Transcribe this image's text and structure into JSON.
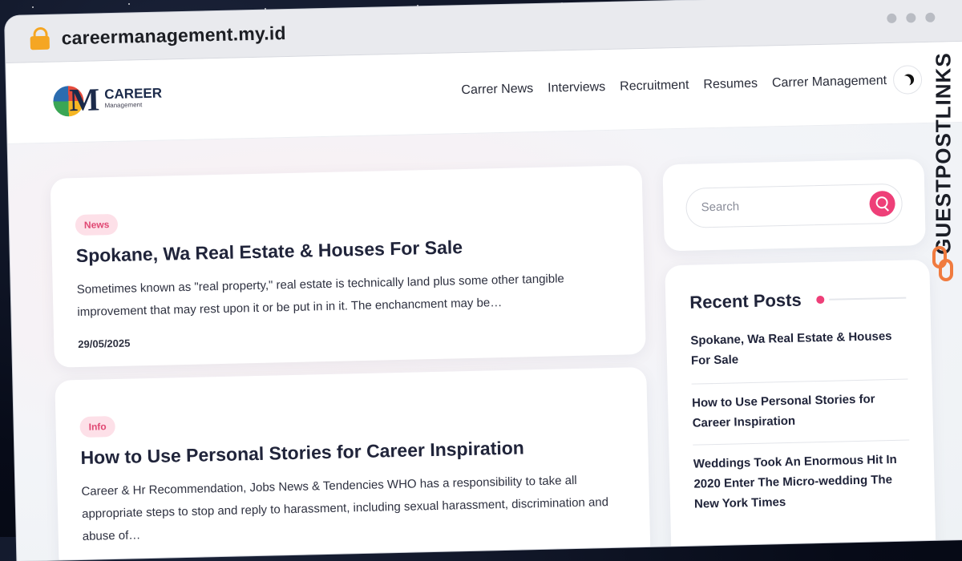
{
  "browser": {
    "url": "careermanagement.my.id"
  },
  "site": {
    "logo_text": "CAREER",
    "logo_sub": "Management",
    "nav": [
      "Carrer News",
      "Interviews",
      "Recruitment",
      "Resumes",
      "Carrer Management"
    ]
  },
  "posts": [
    {
      "badge": "News",
      "title": "Spokane, Wa Real Estate & Houses For Sale",
      "excerpt": "Sometimes known as \"real property,\" real estate is technically land plus some other tangible improvement that may rest upon it or be put in in it. The enchancment may be…",
      "date": "29/05/2025"
    },
    {
      "badge": "Info",
      "title": "How to Use Personal Stories for Career Inspiration",
      "excerpt": "Career & Hr Recommendation, Jobs News & Tendencies WHO has a responsibility to take all appropriate steps to stop and reply to harassment, including sexual harassment, discrimination and abuse of…"
    }
  ],
  "search": {
    "placeholder": "Search"
  },
  "recent": {
    "title": "Recent Posts",
    "items": [
      "Spokane, Wa Real Estate & Houses For Sale",
      "How to Use Personal Stories for Career Inspiration",
      "Weddings Took An Enormous Hit In 2020 Enter The Micro-wedding The New York Times"
    ]
  },
  "watermark": {
    "text": "GUESTPOSTLINKS"
  },
  "colors": {
    "accent": "#ee3f78",
    "badge_bg": "#fde0e8",
    "lock": "#f5a623"
  }
}
